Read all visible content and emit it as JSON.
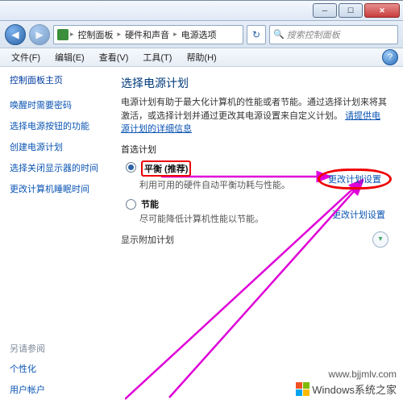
{
  "window": {
    "min": "─",
    "max": "☐",
    "close": "✕"
  },
  "nav": {
    "back": "◀",
    "forward": "▶",
    "crumbs": [
      "控制面板",
      "硬件和声音",
      "电源选项"
    ],
    "search_placeholder": "搜索控制面板",
    "refresh": "↻"
  },
  "menu": {
    "file": "文件(F)",
    "edit": "编辑(E)",
    "view": "查看(V)",
    "tools": "工具(T)",
    "help_label": "帮助(H)",
    "help_icon": "?"
  },
  "sidebar": {
    "home": "控制面板主页",
    "items": [
      "唤醒时需要密码",
      "选择电源按钮的功能",
      "创建电源计划",
      "选择关闭显示器的时间",
      "更改计算机睡眠时间"
    ],
    "related_header": "另请参阅",
    "related": [
      "个性化",
      "用户帐户"
    ]
  },
  "content": {
    "heading": "选择电源计划",
    "desc_a": "电源计划有助于最大化计算机的性能或者节能。通过选择计划来将其激活，或选择计划并通过更改其电源设置来自定义计划。",
    "desc_link": "请提供电源计划的详细信息",
    "preferred_label": "首选计划",
    "plan_balanced": {
      "title": "平衡 (推荐)",
      "desc": "利用可用的硬件自动平衡功耗与性能。"
    },
    "plan_saver": {
      "title": "节能",
      "desc": "尽可能降低计算机性能以节能。"
    },
    "change_settings": "更改计划设置",
    "show_more": "显示附加计划",
    "chevron": "▾"
  },
  "watermark": {
    "text": "Windows系统之家",
    "url": "www.bjjmlv.com"
  }
}
